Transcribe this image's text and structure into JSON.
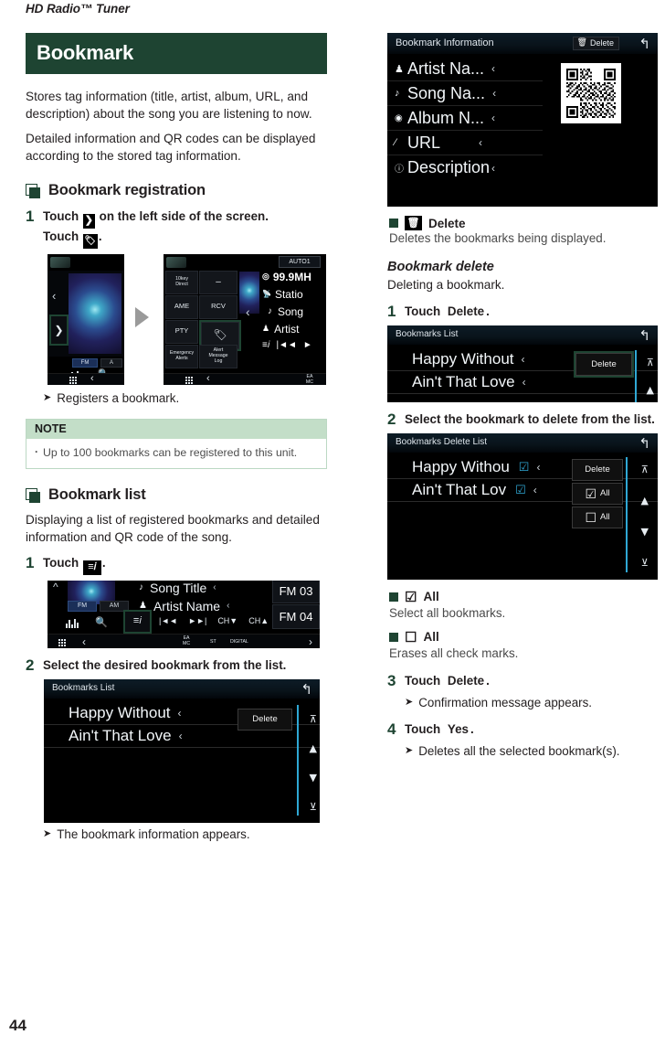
{
  "running_head": "HD Radio™ Tuner",
  "page_number": "44",
  "chapter_title": "Bookmark",
  "intro": [
    "Stores tag information (title, artist, album, URL, and description) about the song you are listening to now.",
    "Detailed information and QR codes can be displayed according to the stored tag information."
  ],
  "registration": {
    "heading": "Bookmark registration",
    "step1_num": "1",
    "step1_text_a": "Touch",
    "step1_text_b": "on the left side of the screen.",
    "step1_text_c": "Touch",
    "step1_text_d": ".",
    "result": "Registers a bookmark.",
    "note_title": "NOTE",
    "note_items": [
      "Up to 100 bookmarks can be registered to this unit."
    ],
    "screen_left": {
      "fm_label": "FM",
      "am_label": "A",
      "chevron_left": "‹",
      "chevron_right": "›",
      "back_chevron": "‹"
    },
    "screen_right": {
      "auto_label": "AUTO1",
      "tile_10key": "10key\nDirect",
      "tile_ame": "AME",
      "tile_rcv": "RCV",
      "tile_pty": "PTY",
      "tile_emergency": "Emergency\nAlerts",
      "tile_alertlog": "Alert\nMessage\nLog",
      "freq": "99.9MH",
      "station": "Statio",
      "song": "Song",
      "artist": "Artist",
      "ea_mc": "EA\nMC"
    }
  },
  "list_section": {
    "heading": "Bookmark list",
    "intro": "Displaying a list of registered bookmarks and detailed information and QR code of the song.",
    "step1_num": "1",
    "step1_text_a": "Touch",
    "step1_text_b": ".",
    "step2_num": "2",
    "step2_text": "Select the desired bookmark from the list.",
    "result": "The bookmark information appears.",
    "radio_screen": {
      "song_title": "Song Title",
      "artist_name": "Artist Name",
      "fm_label": "FM",
      "am_label": "AM",
      "prev": "|◄◄",
      "next": "►►|",
      "ch_down": "CH▼",
      "ch_up": "CH▲",
      "fm03": "FM 03",
      "fm04": "FM 04",
      "ea_mc": "EA\nMC",
      "st": "ST",
      "digital": "DIGITAL"
    },
    "bookmarks_list": {
      "title": "Bookmarks List",
      "items": [
        "Happy Without",
        "Ain't That Love"
      ],
      "delete_label": "Delete"
    }
  },
  "info_screen": {
    "title": "Bookmark Information",
    "delete_label": "Delete",
    "rows": [
      {
        "icon": "artist-icon",
        "glyph": "♟",
        "label": "Artist Na..."
      },
      {
        "icon": "note-icon",
        "glyph": "♪",
        "label": "Song Na..."
      },
      {
        "icon": "disc-icon",
        "glyph": "◉",
        "label": "Album N..."
      },
      {
        "icon": "link-icon",
        "glyph": "⁄",
        "label": "URL"
      },
      {
        "icon": "info-icon",
        "glyph": "ⓘ",
        "label": "Description"
      }
    ],
    "chevron": "‹"
  },
  "delete_bullet": {
    "label": "Delete",
    "desc": "Deletes the bookmarks being displayed.",
    "icon": "trash-icon"
  },
  "delete_section": {
    "heading": "Bookmark delete",
    "intro": "Deleting a bookmark.",
    "step1_num": "1",
    "step1_text_a": "Touch",
    "step1_key": "Delete",
    "step1_text_b": ".",
    "step2_num": "2",
    "step2_text": "Select the bookmark to delete from the list.",
    "step3_num": "3",
    "step3_text_a": "Touch",
    "step3_key": "Delete",
    "step3_text_b": ".",
    "step3_result": "Confirmation message appears.",
    "step4_num": "4",
    "step4_text_a": "Touch",
    "step4_key": "Yes",
    "step4_text_b": ".",
    "step4_result": "Deletes all the selected bookmark(s).",
    "list_screen": {
      "title": "Bookmarks List",
      "items": [
        "Happy Without",
        "Ain't That Love"
      ],
      "delete_label": "Delete"
    },
    "delete_list_screen": {
      "title": "Bookmarks Delete List",
      "items": [
        "Happy Withou",
        "Ain't That Lov"
      ],
      "delete_label": "Delete",
      "all_checked_label": "All",
      "all_unchecked_label": "All"
    },
    "bullets": [
      {
        "glyph": "☑",
        "label": "All",
        "desc": "Select all bookmarks."
      },
      {
        "glyph": "☐",
        "label": "All",
        "desc": "Erases all check marks."
      }
    ]
  },
  "colors": {
    "brand_green": "#1e4432",
    "note_bg": "#c3dec8",
    "note_border": "#bcd8c3",
    "device_accent": "#2fa8d5"
  }
}
